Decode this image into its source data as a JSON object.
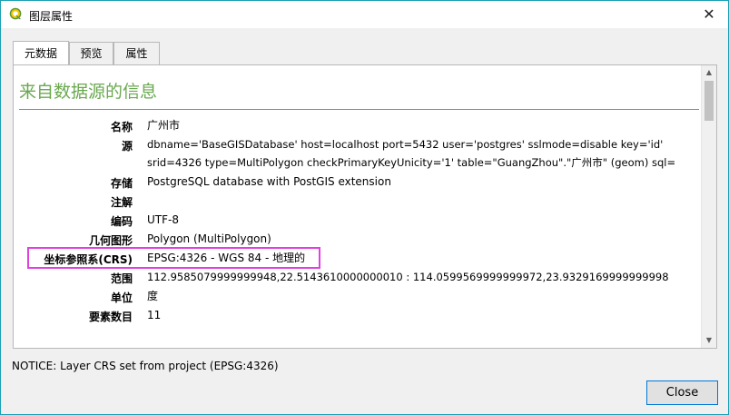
{
  "window": {
    "title": "图层属性",
    "close_glyph": "✕"
  },
  "tabs": [
    {
      "label": "元数据",
      "active": true
    },
    {
      "label": "预览",
      "active": false
    },
    {
      "label": "属性",
      "active": false
    }
  ],
  "metadata": {
    "title": "来自数据源的信息",
    "rows": [
      {
        "label": "名称",
        "value": "广州市"
      },
      {
        "label": "源",
        "value": "dbname='BaseGISDatabase' host=localhost port=5432 user='postgres' sslmode=disable key='id'",
        "value2": "srid=4326 type=MultiPolygon checkPrimaryKeyUnicity='1' table=\"GuangZhou\".\"广州市\" (geom) sql="
      },
      {
        "label": "存储",
        "value": "PostgreSQL database with PostGIS extension"
      },
      {
        "label": "注解",
        "value": ""
      },
      {
        "label": "编码",
        "value": "UTF-8"
      },
      {
        "label": "几何图形",
        "value": "Polygon (MultiPolygon)"
      },
      {
        "label": "坐标参照系(CRS)",
        "value": "EPSG:4326 - WGS 84 - 地理的"
      },
      {
        "label": "范围",
        "value": "112.9585079999999948,22.5143610000000010 : 114.0599569999999972,23.9329169999999998"
      },
      {
        "label": "单位",
        "value": "度"
      },
      {
        "label": "要素数目",
        "value": "11"
      }
    ]
  },
  "status": {
    "notice": "NOTICE: Layer CRS set from project (EPSG:4326)"
  },
  "buttons": {
    "close_label": "Close"
  },
  "colors": {
    "title_green": "#6aa84f",
    "highlight_magenta": "#e040e0",
    "window_border": "#1aa0b4",
    "default_button_border": "#0078d7"
  }
}
